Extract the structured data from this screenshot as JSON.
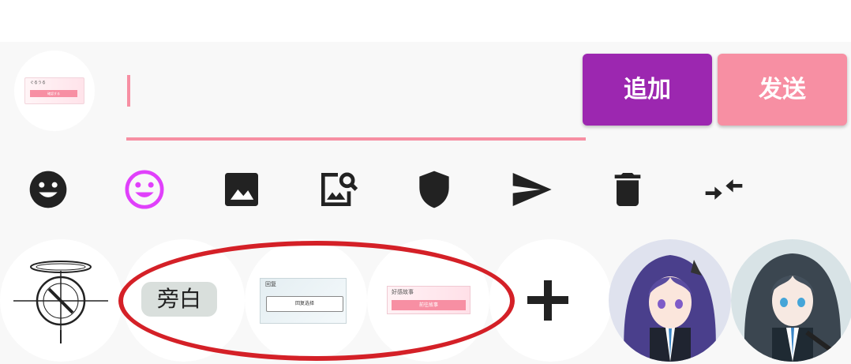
{
  "composer": {
    "input_value": "",
    "add_label": "追加",
    "send_label": "发送"
  },
  "self_avatar": {
    "title": "ぐるうる",
    "button": "確認する"
  },
  "toolbar": {
    "icons": [
      "emoji-icon",
      "emoji-pink-icon",
      "image-icon",
      "image-search-icon",
      "shield-icon",
      "send-icon",
      "delete-icon",
      "collapse-icon"
    ]
  },
  "characters": {
    "narration_label": "旁白",
    "preview_a": {
      "title": "回复",
      "button": "回复选择"
    },
    "preview_b": {
      "title": "好感故事",
      "button": "前往故事"
    },
    "add_icon": "plus-icon",
    "portraits": [
      "purple-hair-student-avatar",
      "dark-hair-student-avatar"
    ]
  },
  "colors": {
    "accent_pink": "#f78fa3",
    "accent_purple": "#9c27b0",
    "annotation_red": "#d42027",
    "emoji_purple": "#e040fb"
  }
}
